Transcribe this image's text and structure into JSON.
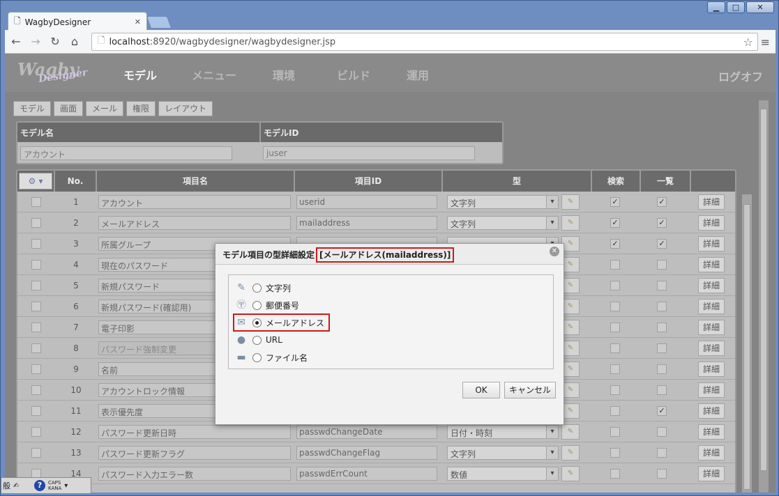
{
  "browser": {
    "tab_title": "WagbyDesigner",
    "url_host": "localhost",
    "url_rest": ":8920/wagbydesigner/wagbydesigner.jsp"
  },
  "app": {
    "logo_text": "Wagby",
    "logo_sub": "Designer",
    "nav": [
      "モデル",
      "メニュー",
      "環境",
      "ビルド",
      "運用"
    ],
    "logout": "ログオフ",
    "subtabs": [
      "モデル",
      "画面",
      "メール",
      "権限",
      "レイアウト"
    ]
  },
  "model": {
    "name_label": "モデル名",
    "id_label": "モデルID",
    "name_value": "アカウント",
    "id_value": "juser"
  },
  "grid": {
    "headers": {
      "no": "No.",
      "name": "項目名",
      "id": "項目ID",
      "type": "型",
      "search": "検索",
      "list": "一覧"
    },
    "detail_label": "詳細",
    "rows": [
      {
        "no": "1",
        "name": "アカウント",
        "id": "userid",
        "type": "文字列",
        "search": true,
        "list": true,
        "disabled": false
      },
      {
        "no": "2",
        "name": "メールアドレス",
        "id": "mailaddress",
        "type": "文字列",
        "search": true,
        "list": true,
        "disabled": false
      },
      {
        "no": "3",
        "name": "所属グループ",
        "id": "",
        "type": "",
        "search": true,
        "list": true,
        "disabled": false
      },
      {
        "no": "4",
        "name": "現在のパスワード",
        "id": "",
        "type": "",
        "search": false,
        "list": false,
        "disabled": false
      },
      {
        "no": "5",
        "name": "新規パスワード",
        "id": "",
        "type": "",
        "search": false,
        "list": false,
        "disabled": false
      },
      {
        "no": "6",
        "name": "新規パスワード(確認用)",
        "id": "",
        "type": "",
        "search": false,
        "list": false,
        "disabled": false
      },
      {
        "no": "7",
        "name": "電子印影",
        "id": "",
        "type": "",
        "search": false,
        "list": false,
        "disabled": false
      },
      {
        "no": "8",
        "name": "パスワード強制変更",
        "id": "",
        "type": "",
        "search": false,
        "list": false,
        "disabled": true
      },
      {
        "no": "9",
        "name": "名前",
        "id": "",
        "type": "",
        "search": false,
        "list": false,
        "disabled": false
      },
      {
        "no": "10",
        "name": "アカウントロック情報",
        "id": "",
        "type": "",
        "search": false,
        "list": false,
        "disabled": false
      },
      {
        "no": "11",
        "name": "表示優先度",
        "id": "",
        "type": "",
        "search": false,
        "list": true,
        "disabled": false
      },
      {
        "no": "12",
        "name": "パスワード更新日時",
        "id": "passwdChangeDate",
        "type": "日付・時刻",
        "search": false,
        "list": false,
        "disabled": false
      },
      {
        "no": "13",
        "name": "パスワード更新フラグ",
        "id": "passwdChangeFlag",
        "type": "文字列",
        "search": false,
        "list": false,
        "disabled": false
      },
      {
        "no": "14",
        "name": "パスワード入力エラー数",
        "id": "passwdErrCount",
        "type": "数値",
        "search": false,
        "list": false,
        "disabled": false
      }
    ]
  },
  "dialog": {
    "title": "モデル項目の型詳細設定",
    "title_highlight": "[メールアドレス(mailaddress)]",
    "options": [
      {
        "label": "文字列",
        "icon": "pencil-icon",
        "selected": false
      },
      {
        "label": "郵便番号",
        "icon": "postal-icon",
        "selected": false
      },
      {
        "label": "メールアドレス",
        "icon": "mail-icon",
        "selected": true
      },
      {
        "label": "URL",
        "icon": "globe-icon",
        "selected": false
      },
      {
        "label": "ファイル名",
        "icon": "folder-icon",
        "selected": false
      }
    ],
    "ok": "OK",
    "cancel": "キャンセル"
  },
  "ime": {
    "caps": "CAPS",
    "kana": "KANA",
    "mode": "般"
  }
}
